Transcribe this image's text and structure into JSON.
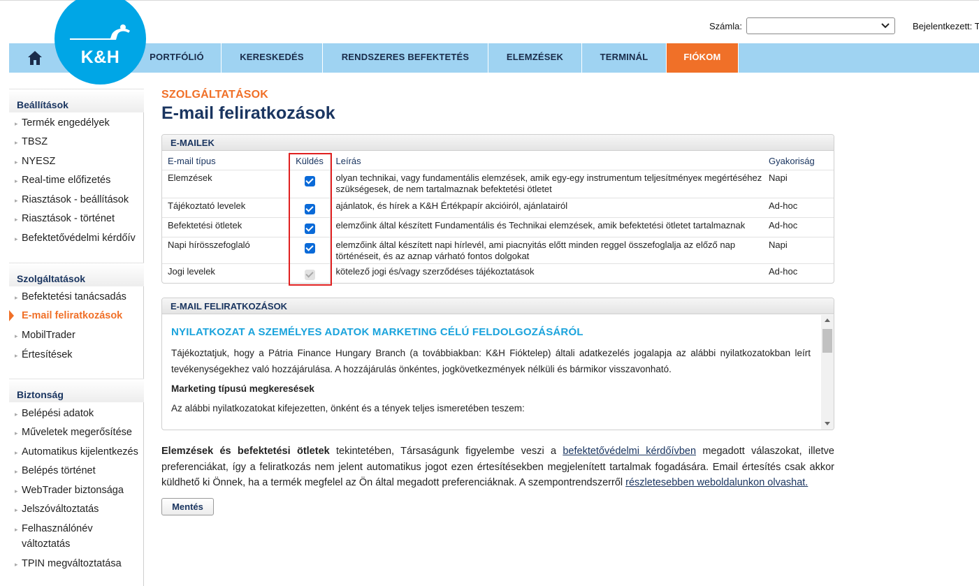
{
  "header": {
    "account_label": "Számla:",
    "account_value": "",
    "logged_in": "Bejelentkezett: T",
    "logo_text": "K&H"
  },
  "nav": [
    {
      "label": "PORTFÓLIÓ",
      "active": false
    },
    {
      "label": "KERESKEDÉS",
      "active": false
    },
    {
      "label": "RENDSZERES BEFEKTETÉS",
      "active": false
    },
    {
      "label": "ELEMZÉSEK",
      "active": false
    },
    {
      "label": "TERMINÁL",
      "active": false
    },
    {
      "label": "FIÓKOM",
      "active": true
    }
  ],
  "sidebar": {
    "groups": [
      {
        "title": "Beállítások",
        "items": [
          "Termék engedélyek",
          "TBSZ",
          "NYESZ",
          "Real-time előfizetés",
          "Riasztások - beállítások",
          "Riasztások - történet",
          "Befektetővédelmi kérdőív"
        ]
      },
      {
        "title": "Szolgáltatások",
        "items": [
          "Befektetési tanácsadás",
          "E-mail feliratkozások",
          "MobilTrader",
          "Értesítések"
        ],
        "active": "E-mail feliratkozások"
      },
      {
        "title": "Biztonság",
        "items": [
          "Belépési adatok",
          "Műveletek megerősítése",
          "Automatikus kijelentkezés",
          "Belépés történet",
          "WebTrader biztonsága",
          "Jelszóváltoztatás",
          "Felhasználónév",
          "változtatás",
          "TPIN megváltoztatása"
        ]
      }
    ]
  },
  "main": {
    "section": "SZOLGÁLTATÁSOK",
    "title": "E-mail feliratkozások"
  },
  "emails_panel": {
    "title": "E-MAILEK",
    "columns": {
      "type": "E-mail típus",
      "send": "Küldés",
      "desc": "Leírás",
      "freq": "Gyakoriság"
    },
    "rows": [
      {
        "type": "Elemzések",
        "checked": true,
        "disabled": false,
        "desc": "olyan technikai, vagy fundamentális elemzések, amik egy-egy instrumentum teljesítményeк megértéséhez szükségesek, de nem tartalmaznak befektetési ötletet",
        "freq": "Napi"
      },
      {
        "type": "Tájékoztató levelek",
        "checked": true,
        "disabled": false,
        "desc": "ajánlatok, és hírek a K&H Értékpapír akcióiról, ajánlatairól",
        "freq": "Ad-hoc"
      },
      {
        "type": "Befektetési ötletek",
        "checked": true,
        "disabled": false,
        "desc": "elemzőink által készített Fundamentális és Technikai elemzések, amik befektetési ötletet tartalmaznak",
        "freq": "Ad-hoc"
      },
      {
        "type": "Napi hírösszefoglaló",
        "checked": true,
        "disabled": false,
        "desc": "elemzőink által készített napi hírlevél, ami piacnyitás előtt minden reggel összefoglalja az előző nap történéseit, és az aznap várható fontos dolgokat",
        "freq": "Napi"
      },
      {
        "type": "Jogi levelek",
        "checked": true,
        "disabled": true,
        "desc": "kötelező jogi és/vagy szerződéses tájékoztatások",
        "freq": "Ad-hoc"
      }
    ]
  },
  "subs_panel": {
    "title": "E-MAIL FELIRATKOZÁSOK",
    "heading": "NYILATKOZAT A SZEMÉLYES ADATOK MARKETING CÉLÚ FELDOLGOZÁSÁRÓL",
    "para1": "Tájékoztatjuk, hogy a Pátria Finance Hungary Branch (a továbbiakban: K&H Fióktelep) általi adatkezelés jogalapja az alábbi nyilatkozatokban leírt tevékenységekhez való hozzájárulása. A hozzájárulás önkéntes, jogkövetkezmények nélküli és bármikor visszavonható.",
    "sub": "Marketing típusú megkeresések",
    "para2": "Az alábbi nyilatkozatokat kifejezetten, önként és a tények teljes ismeretében teszem:"
  },
  "info": {
    "bold": "Elemzések és befektetési ötletek",
    "t1": " tekintetében, Társaságunk figyelembe veszi a ",
    "link1": "befektetővédelmi kérdőívben",
    "t2": " megadott válaszokat, illetve preferenciákat, így a feliratkozás nem jelent automatikus jogot ezen értesítésekben megjelenített tartalmak fogadására. Email értesítés csak akkor küldhető ki Önnek, ha a termék megfelel az Ön által megadott preferenciáknak. A szempontrendszerről ",
    "link2": "részletesebben weboldalunkon olvashat."
  },
  "save_label": "Mentés",
  "colors": {
    "nav": "#9fd3f2",
    "accent": "#f07028",
    "brand": "#00a6e6",
    "title": "#1a3560",
    "highlight": "#e02020"
  }
}
